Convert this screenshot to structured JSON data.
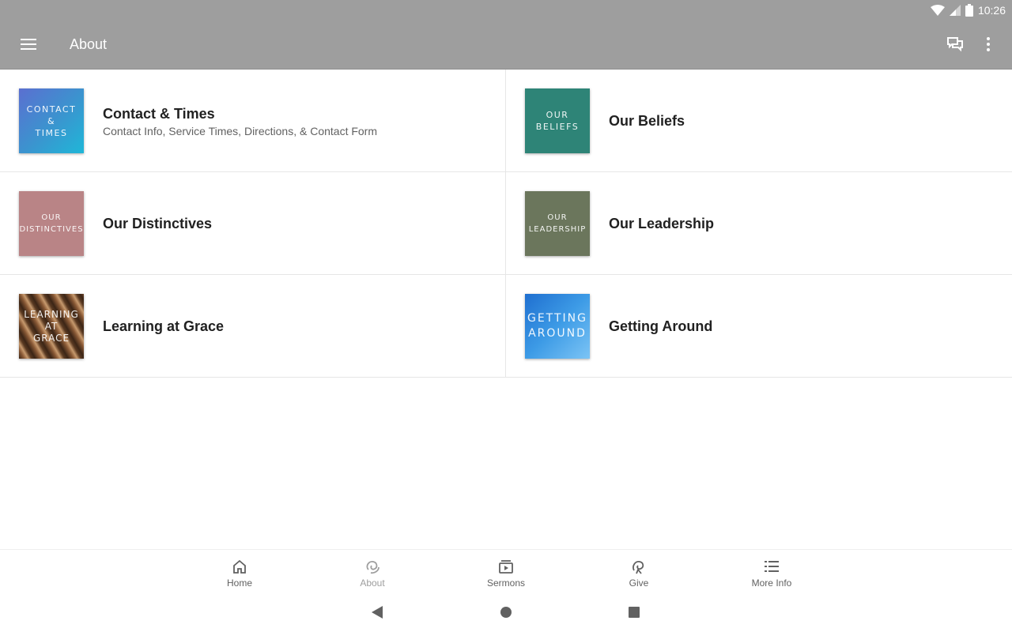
{
  "status": {
    "time": "10:26",
    "icons": [
      "wifi-icon",
      "signal-icon",
      "battery-icon"
    ]
  },
  "appbar": {
    "title": "About",
    "background": "#9e9e9e",
    "icons": [
      "menu-icon",
      "chat-icon",
      "more-vert-icon"
    ]
  },
  "items": [
    {
      "title": "Contact & Times",
      "subtitle": "Contact Info, Service Times, Directions, & Contact Form",
      "thumb_lines": [
        "CONTACT",
        "&",
        "TIMES"
      ],
      "thumb_color": "#3f8fc9"
    },
    {
      "title": "Our Beliefs",
      "thumb_lines": [
        "OUR",
        "BELIEFS"
      ],
      "thumb_color": "#2e8477"
    },
    {
      "title": "Our Distinctives",
      "thumb_lines": [
        "OUR",
        "DISTINCTIVES"
      ],
      "thumb_color": "#b98486"
    },
    {
      "title": "Our Leadership",
      "thumb_lines": [
        "OUR",
        "LEADERSHIP"
      ],
      "thumb_color": "#6b765c"
    },
    {
      "title": "Learning at Grace",
      "thumb_lines": [
        "LEARNING",
        "AT",
        "GRACE"
      ],
      "thumb_color": "#6e4a2f"
    },
    {
      "title": "Getting Around",
      "thumb_lines": [
        "GETTING",
        "AROUND"
      ],
      "thumb_color": "#3a8fdc"
    }
  ],
  "bottom_nav": [
    {
      "label": "Home",
      "icon": "home-icon"
    },
    {
      "label": "About",
      "icon": "about-icon",
      "active": true
    },
    {
      "label": "Sermons",
      "icon": "sermons-icon"
    },
    {
      "label": "Give",
      "icon": "give-icon"
    },
    {
      "label": "More Info",
      "icon": "list-icon"
    }
  ],
  "system_nav": [
    "back-icon",
    "home-circle-icon",
    "recents-icon"
  ]
}
